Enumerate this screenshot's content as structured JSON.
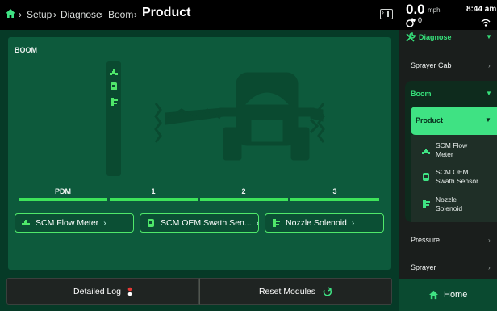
{
  "breadcrumb": {
    "items": [
      "Setup",
      "Diagnose",
      "Boom"
    ],
    "separator": "›",
    "current": "Product"
  },
  "status": {
    "speed": "0.0",
    "speed_unit": "mph",
    "gps_count": "0",
    "time": "8:44",
    "time_suffix": "am"
  },
  "boom": {
    "title": "BOOM",
    "sections": [
      "PDM",
      "1",
      "2",
      "3"
    ],
    "modules": [
      {
        "label": "SCM Flow Meter",
        "icon": "flow-meter-icon"
      },
      {
        "label": "SCM OEM Swath Sen...",
        "icon": "swath-sensor-icon"
      },
      {
        "label": "Nozzle Solenoid",
        "icon": "nozzle-solenoid-icon"
      }
    ],
    "accent": "#4fe86a"
  },
  "buttons": {
    "detailed_log": "Detailed Log",
    "reset_modules": "Reset Modules"
  },
  "sidebar": {
    "header": "Diagnose",
    "items": {
      "sprayer_cab": "Sprayer Cab",
      "boom": "Boom",
      "product": "Product",
      "pressure": "Pressure",
      "sprayer": "Sprayer"
    },
    "product_items": [
      {
        "line1": "SCM Flow",
        "line2": "Meter",
        "icon": "flow-meter-icon"
      },
      {
        "line1": "SCM OEM",
        "line2": "Swath Sensor",
        "icon": "swath-sensor-icon"
      },
      {
        "line1": "Nozzle",
        "line2": "Solenoid",
        "icon": "nozzle-solenoid-icon"
      }
    ],
    "home": "Home",
    "accent": "#3fe283"
  }
}
